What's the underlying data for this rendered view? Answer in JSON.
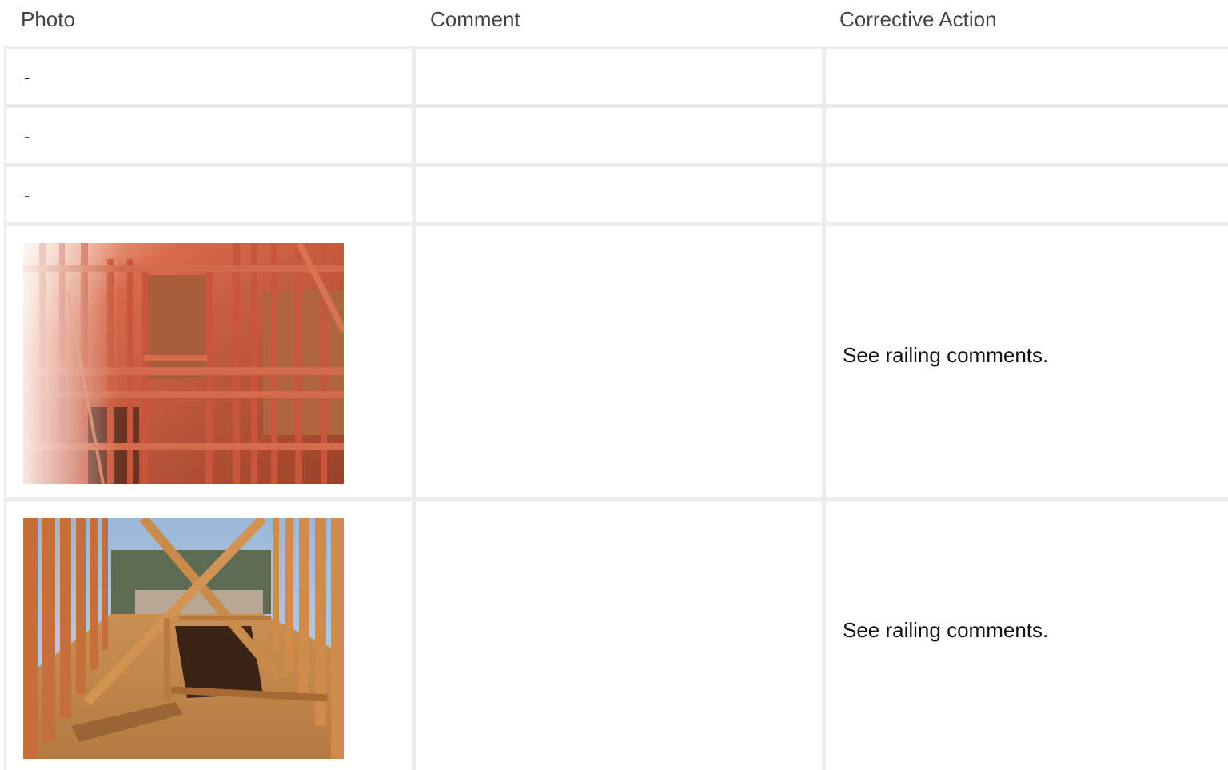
{
  "table": {
    "headers": {
      "photo": "Photo",
      "comment": "Comment",
      "corrective_action": "Corrective Action"
    },
    "rows": [
      {
        "photo": "-",
        "comment": "",
        "corrective_action": ""
      },
      {
        "photo": "-",
        "comment": "",
        "corrective_action": ""
      },
      {
        "photo": "-",
        "comment": "",
        "corrective_action": ""
      },
      {
        "photo_image": "construction-framing-wall",
        "comment": "",
        "corrective_action": "See railing comments."
      },
      {
        "photo_image": "construction-framing-stair-opening",
        "comment": "",
        "corrective_action": "See railing comments."
      }
    ]
  },
  "colors": {
    "grid_line": "#ececec",
    "header_text": "#444444",
    "body_text": "#111111"
  }
}
